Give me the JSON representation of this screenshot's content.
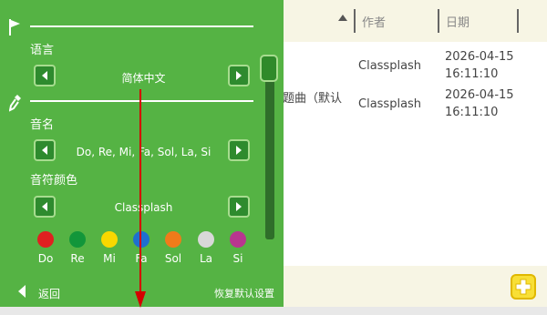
{
  "settings": {
    "language_label": "语言",
    "language_value": "简体中文",
    "note_name_label": "音名",
    "note_name_value": "Do, Re, Mi, Fa, Sol, La, Si",
    "note_color_label": "音符颜色",
    "note_color_value": "Classplash",
    "notes": [
      {
        "label": "Do",
        "color": "#e02020"
      },
      {
        "label": "Re",
        "color": "#12963a"
      },
      {
        "label": "Mi",
        "color": "#f8d800"
      },
      {
        "label": "Fa",
        "color": "#1f6fcf"
      },
      {
        "label": "Sol",
        "color": "#f07b1a"
      },
      {
        "label": "La",
        "color": "#d8d8d8"
      },
      {
        "label": "Si",
        "color": "#b8368f"
      }
    ],
    "back_label": "返回",
    "restore_label": "恢复默认设置"
  },
  "table": {
    "header_author": "作者",
    "header_date": "日期",
    "rows": [
      {
        "title": "",
        "author": "Classplash",
        "date": "2026-04-15",
        "time": "16:11:10"
      },
      {
        "title": "题曲（默认",
        "author": "Classplash",
        "date": "2026-04-15",
        "time": "16:11:10"
      }
    ]
  },
  "colors": {
    "panel": "#55b344",
    "accent_arrow": "#d40000"
  }
}
